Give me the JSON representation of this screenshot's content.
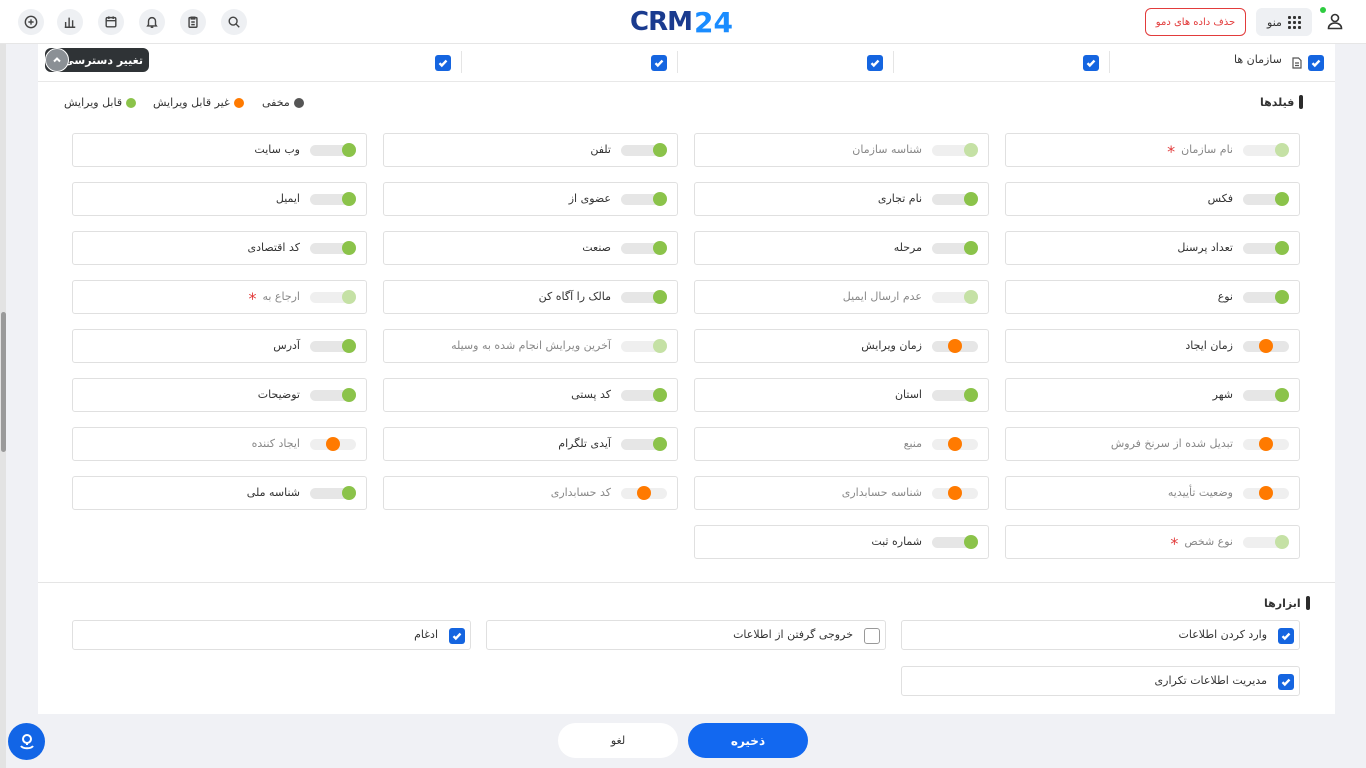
{
  "header": {
    "logo_crm": "CRM",
    "logo_24": "24",
    "delete_demo_label": "حذف داده های دمو",
    "menu_label": "منو",
    "icons": [
      "add-circle-icon",
      "bar-chart-icon",
      "calendar-icon",
      "bell-icon",
      "clipboard-icon",
      "search-icon",
      "grid-menu-icon",
      "user-icon"
    ]
  },
  "permissions": {
    "entity_label": "سازمان ها",
    "toggle_tip_label": "تغییر دسترسی"
  },
  "legend": {
    "editable": "قابل ویرایش",
    "read_only": "غیر قابل ویرایش",
    "hidden": "مخفی"
  },
  "colors": {
    "editable": "#8bc34a",
    "read_only": "#ff7a00",
    "hidden": "#555555",
    "primary": "#1268f0",
    "danger": "#e23b3b"
  },
  "fields_section": {
    "title": "فیلدها",
    "rows": [
      [
        {
          "label": "نام سازمان",
          "required": true,
          "state": "locked"
        },
        {
          "label": "شناسه سازمان",
          "required": false,
          "state": "locked"
        },
        {
          "label": "تلفن",
          "required": false,
          "state": "editable"
        },
        {
          "label": "وب سایت",
          "required": false,
          "state": "editable"
        }
      ],
      [
        {
          "label": "فکس",
          "required": false,
          "state": "editable"
        },
        {
          "label": "نام تجاری",
          "required": false,
          "state": "editable"
        },
        {
          "label": "عضوی از",
          "required": false,
          "state": "editable"
        },
        {
          "label": "ایمیل",
          "required": false,
          "state": "editable"
        }
      ],
      [
        {
          "label": "تعداد پرسنل",
          "required": false,
          "state": "editable"
        },
        {
          "label": "مرحله",
          "required": false,
          "state": "editable"
        },
        {
          "label": "صنعت",
          "required": false,
          "state": "editable"
        },
        {
          "label": "کد اقتصادی",
          "required": false,
          "state": "editable"
        }
      ],
      [
        {
          "label": "نوع",
          "required": false,
          "state": "editable"
        },
        {
          "label": "عدم ارسال ایمیل",
          "required": false,
          "state": "locked"
        },
        {
          "label": "مالک را آگاه کن",
          "required": false,
          "state": "editable"
        },
        {
          "label": "ارجاع به",
          "required": true,
          "state": "locked"
        }
      ],
      [
        {
          "label": "زمان ایجاد",
          "required": false,
          "state": "readonly"
        },
        {
          "label": "زمان ویرایش",
          "required": false,
          "state": "readonly"
        },
        {
          "label": "آخرین ویرایش انجام شده به وسیله",
          "required": false,
          "state": "locked"
        },
        {
          "label": "آدرس",
          "required": false,
          "state": "editable"
        }
      ],
      [
        {
          "label": "شهر",
          "required": false,
          "state": "editable"
        },
        {
          "label": "استان",
          "required": false,
          "state": "editable"
        },
        {
          "label": "کد پستی",
          "required": false,
          "state": "editable"
        },
        {
          "label": "توضیحات",
          "required": false,
          "state": "editable"
        }
      ],
      [
        {
          "label": "تبدیل شده از سرنخ فروش",
          "required": false,
          "state": "readonly"
        },
        {
          "label": "منبع",
          "required": false,
          "state": "readonly"
        },
        {
          "label": "آیدی تلگرام",
          "required": false,
          "state": "editable"
        },
        {
          "label": "ایجاد کننده",
          "required": false,
          "state": "readonly"
        }
      ],
      [
        {
          "label": "وضعیت تأییدیه",
          "required": false,
          "state": "readonly"
        },
        {
          "label": "شناسه حسابداری",
          "required": false,
          "state": "readonly"
        },
        {
          "label": "کد حسابداری",
          "required": false,
          "state": "readonly"
        },
        {
          "label": "شناسه ملی",
          "required": false,
          "state": "editable"
        }
      ],
      [
        {
          "label": "نوع شخص",
          "required": true,
          "state": "locked"
        },
        {
          "label": "شماره ثبت",
          "required": false,
          "state": "editable"
        }
      ]
    ]
  },
  "tools_section": {
    "title": "ابزارها",
    "items": [
      {
        "label": "وارد کردن اطلاعات",
        "checked": true
      },
      {
        "label": "خروجی گرفتن از اطلاعات",
        "checked": false
      },
      {
        "label": "ادغام",
        "checked": true
      },
      {
        "label": "مدیریت اطلاعات تکراری",
        "checked": true
      }
    ]
  },
  "footer": {
    "save_label": "ذخیره",
    "cancel_label": "لغو"
  }
}
